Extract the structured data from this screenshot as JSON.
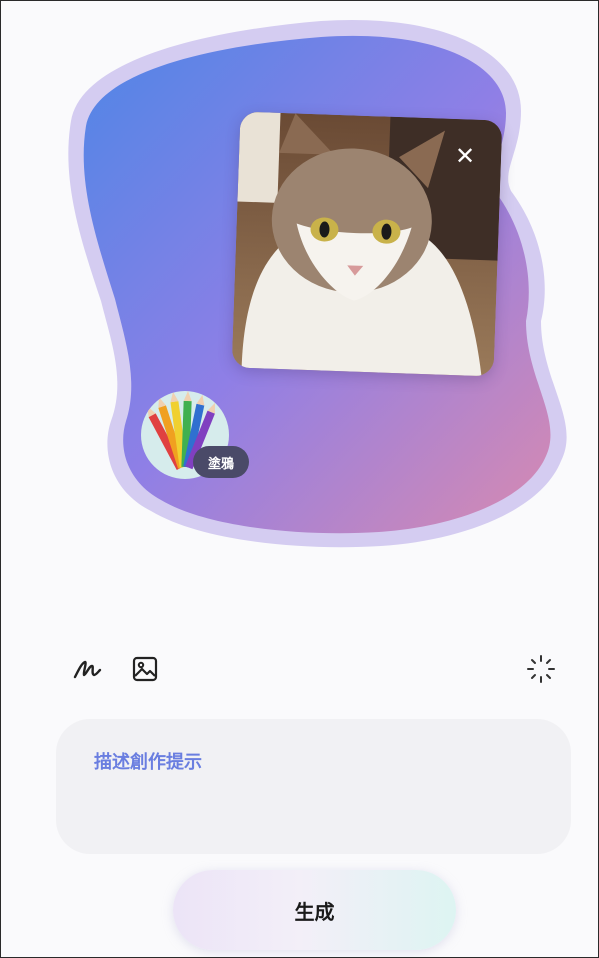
{
  "canvas": {
    "photo": {
      "alt": "cat photo",
      "remove_icon": "close-icon"
    },
    "style": {
      "icon": "colored-pencils-icon",
      "label": "塗鴉"
    },
    "colors": {
      "blob_start": "#4f86e6",
      "blob_mid": "#8f7fe6",
      "blob_end": "#d88ab0",
      "blob_outline": "#cfc6ef"
    }
  },
  "toolbar": {
    "left_tools": [
      {
        "name": "draw",
        "icon": "pen-scribble-icon"
      },
      {
        "name": "image",
        "icon": "image-icon"
      }
    ],
    "right_tool": {
      "name": "ai-suggest",
      "icon": "sparkle-icon"
    }
  },
  "prompt": {
    "placeholder": "描述創作提示",
    "value": ""
  },
  "generate": {
    "label": "生成"
  }
}
